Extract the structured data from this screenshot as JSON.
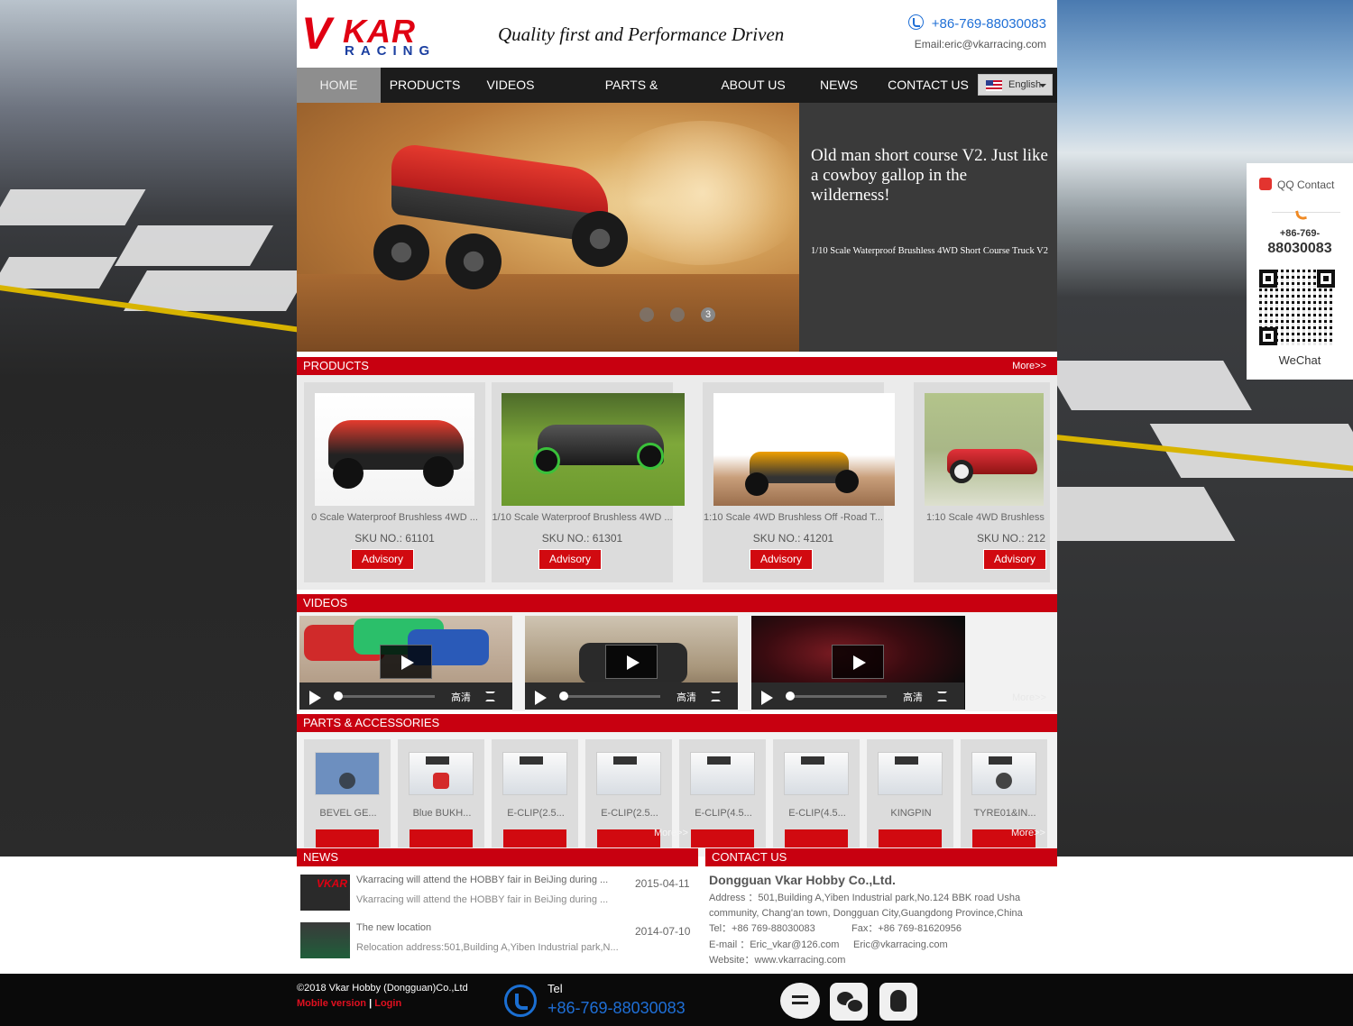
{
  "header": {
    "logo_text": "VKAR",
    "logo_sub": "RACING",
    "tagline": "Quality first and Performance Driven",
    "phone": "+86-769-88030083",
    "email": "Email:eric@vkarracing.com"
  },
  "nav": {
    "items": [
      "HOME",
      "PRODUCTS",
      "VIDEOS",
      "PARTS & ACCESSORIES",
      "ABOUT US",
      "NEWS",
      "CONTACT US"
    ],
    "active": "HOME",
    "language": "English"
  },
  "banner": {
    "headline": "Old man short course V2. Just like a cowboy gallop in the wilderness!",
    "subtitle": "1/10 Scale Waterproof Brushless 4WD Short Course Truck V2",
    "dots": [
      "",
      "",
      "3"
    ],
    "current_slide": 3
  },
  "products": {
    "title": "PRODUCTS",
    "more": "More>>",
    "items": [
      {
        "name": "0 Scale Waterproof Brushless 4WD ...",
        "sku": "SKU NO.: 61101",
        "button": "Advisory"
      },
      {
        "name": "1/10 Scale Waterproof Brushless 4WD ...",
        "sku": "SKU NO.: 61301",
        "button": "Advisory"
      },
      {
        "name": "1:10 Scale 4WD Brushless Off -Road T...",
        "sku": "SKU NO.: 41201",
        "button": "Advisory"
      },
      {
        "name": "1:10 Scale 4WD Brushless",
        "sku": "SKU NO.: 212",
        "button": "Advisory"
      }
    ]
  },
  "videos": {
    "title": "VIDEOS",
    "more": "More>>",
    "quality_label": "高清",
    "count": 3
  },
  "parts": {
    "title": "PARTS & ACCESSORIES",
    "more": "More>>",
    "items": [
      "BEVEL GE...",
      "Blue BUKH...",
      "E-CLIP(2.5...",
      "E-CLIP(2.5...",
      "E-CLIP(4.5...",
      "E-CLIP(4.5...",
      "KINGPIN",
      "TYRE01&IN..."
    ]
  },
  "news": {
    "title": "NEWS",
    "items": [
      {
        "title": "Vkarracing will attend the HOBBY fair in BeiJing during ...",
        "desc": "Vkarracing will attend the HOBBY fair in BeiJing during ...",
        "date": "2015-04-11"
      },
      {
        "title": "The new location",
        "desc": "Relocation address:501,Building A,Yiben Industrial park,N...",
        "date": "2014-07-10"
      }
    ]
  },
  "contact": {
    "title": "CONTACT US",
    "company": "Dongguan Vkar Hobby Co.,Ltd.",
    "address1": "Address ：501,Building A,Yiben Industrial park,No.124 BBK road Usha",
    "address2": "community, Chang'an town, Dongguan City,Guangdong Province,China",
    "tel": "Tel：+86 769-88030083",
    "fax": "Fax：+86 769-81620956",
    "email1": "E-mail ：Eric_vkar@126.com",
    "email2": "Eric@vkarracing.com",
    "website": "Website：www.vkarracing.com"
  },
  "sidebar": {
    "qq": "QQ Contact",
    "phone_a": "+86-769-",
    "phone_b": "88030083",
    "wechat": "WeChat"
  },
  "footer": {
    "copyright": "©2018 Vkar Hobby (Dongguan)Co.,Ltd",
    "mobile": "Mobile version",
    "separator": "|",
    "login": "Login",
    "tel_label": "Tel",
    "tel_number": "+86-769-88030083"
  },
  "colors": {
    "brand_red": "#c80010",
    "nav_bg": "#1c1c1c",
    "link_blue": "#1f6fd6"
  }
}
